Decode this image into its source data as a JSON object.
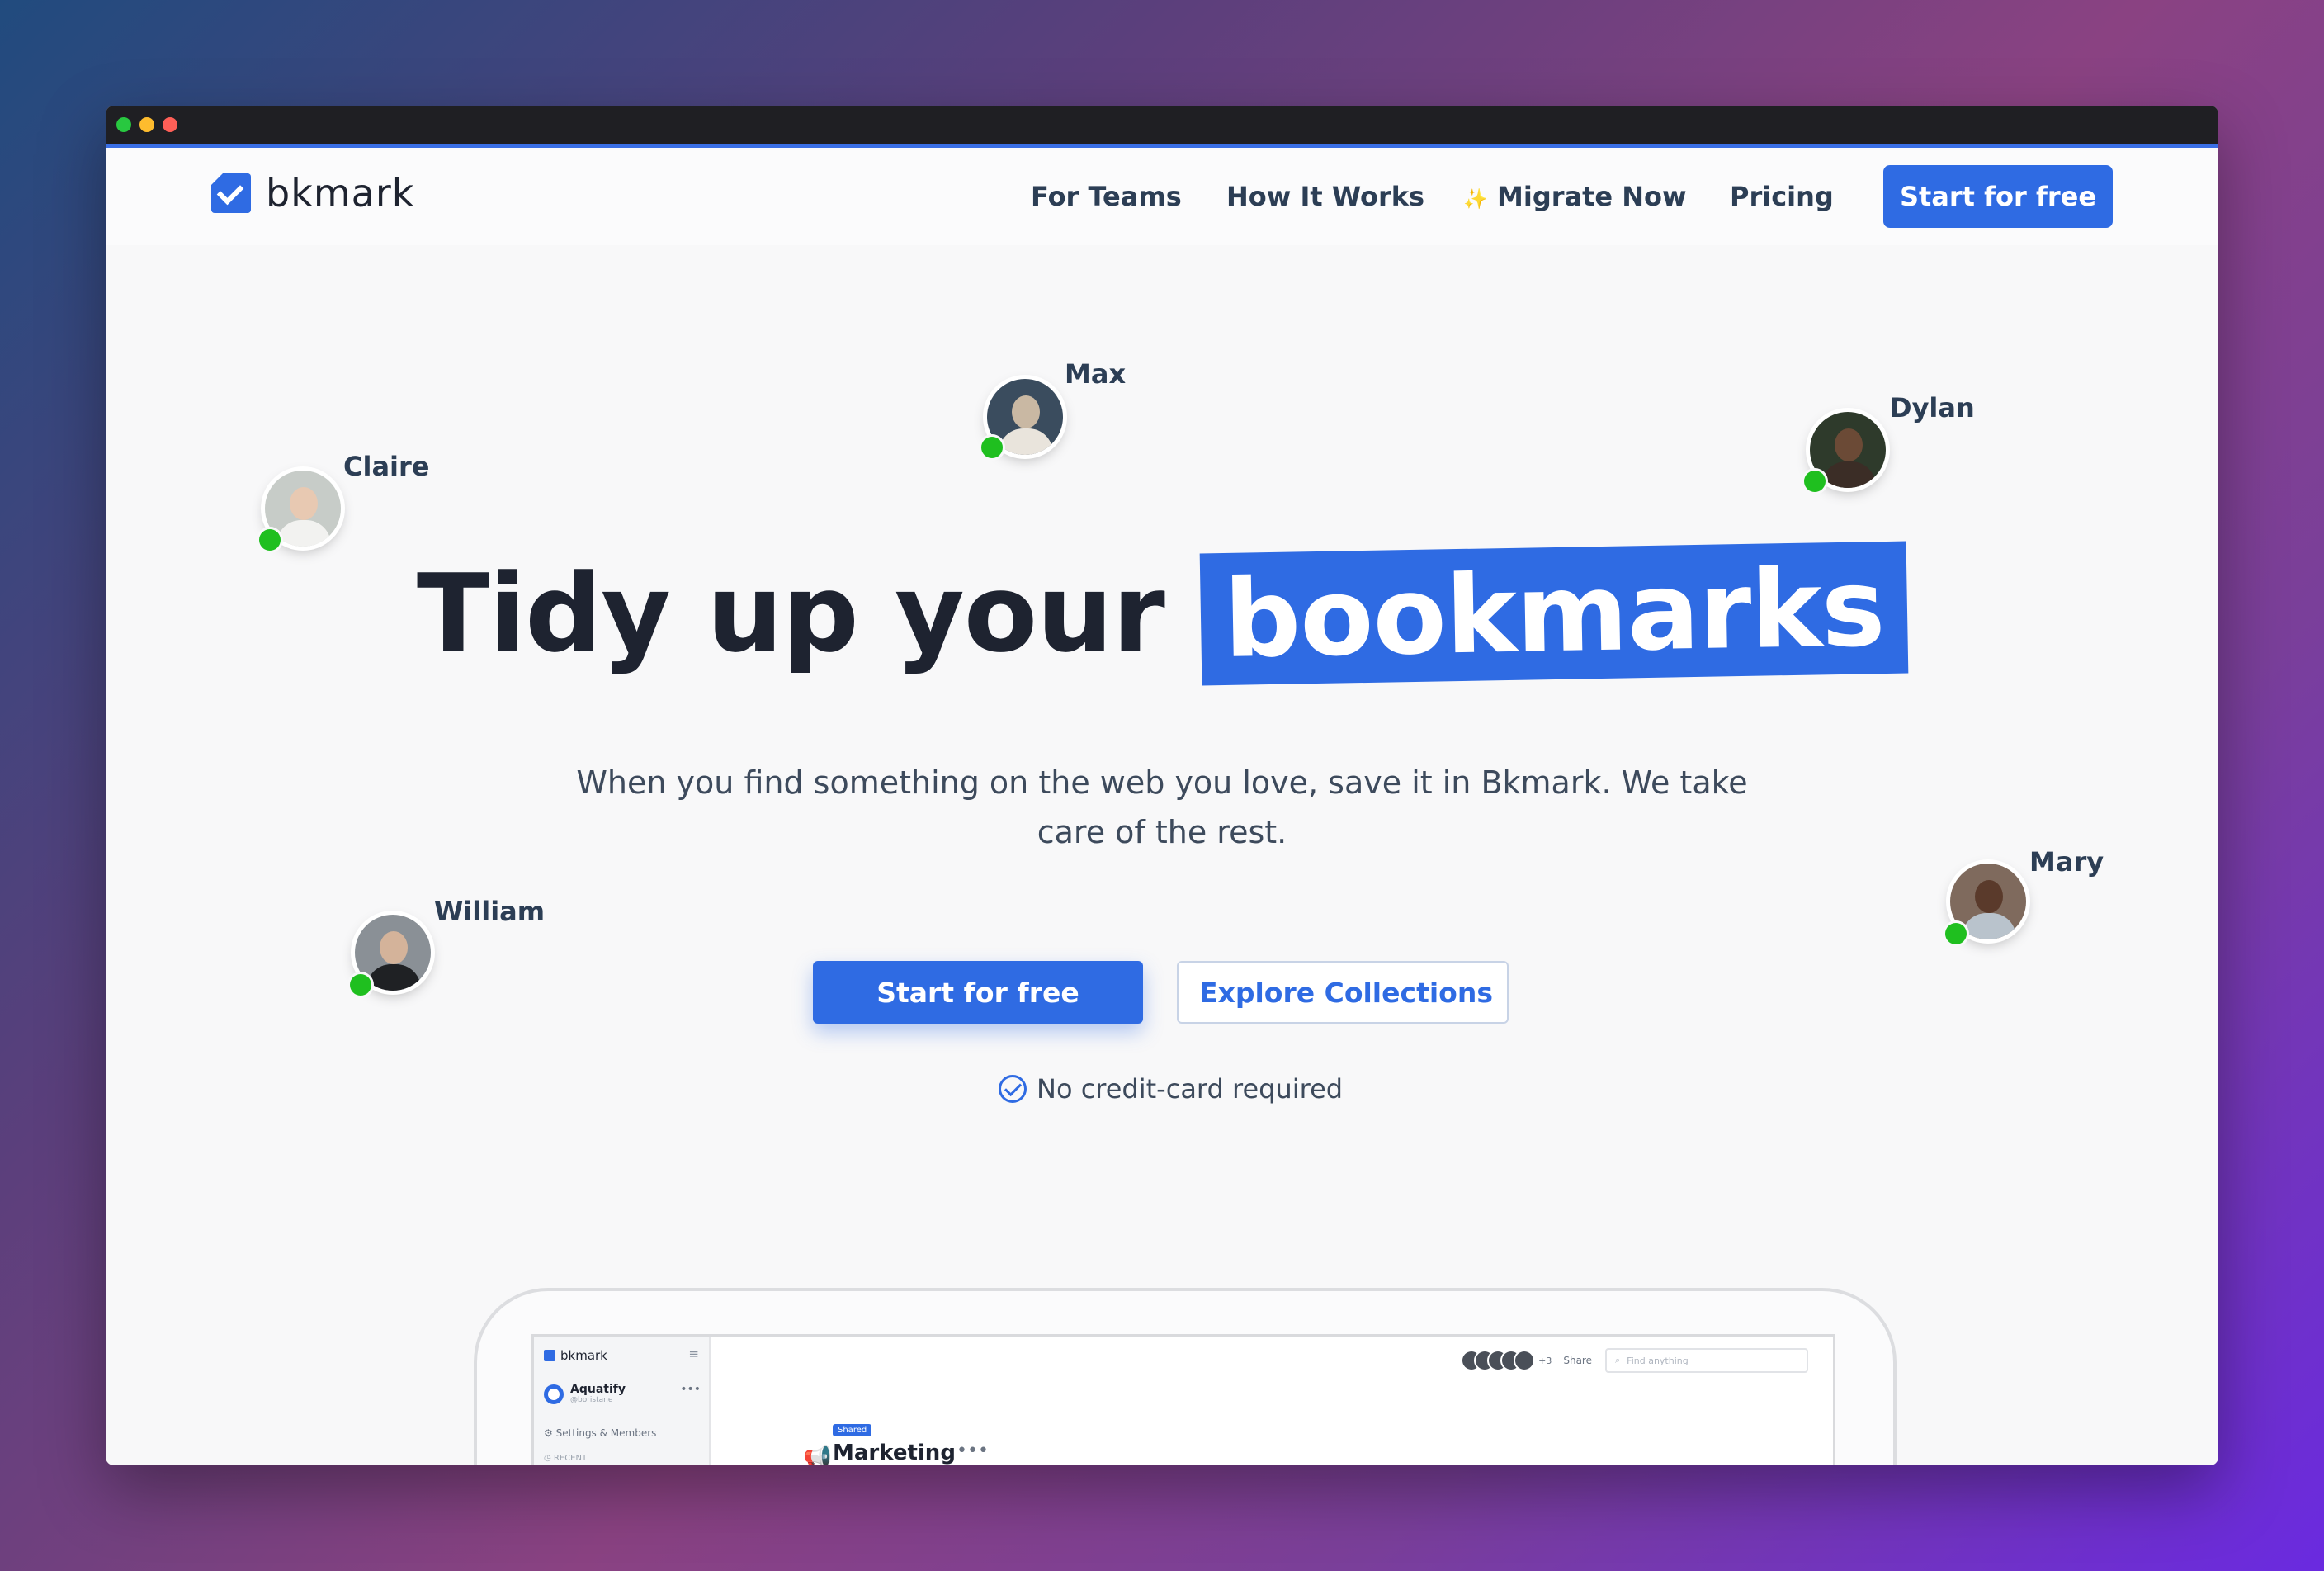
{
  "window": {
    "controls": [
      "green",
      "yellow",
      "red"
    ]
  },
  "nav": {
    "logo_text": "bkmark",
    "links": [
      "For Teams",
      "How It Works",
      "Migrate Now",
      "Pricing"
    ],
    "migrate_icon": "✨",
    "cta": "Start for free"
  },
  "avatars": [
    {
      "name": "Max"
    },
    {
      "name": "Dylan"
    },
    {
      "name": "Claire"
    },
    {
      "name": "William"
    },
    {
      "name": "Mary"
    }
  ],
  "hero": {
    "title_plain": "Tidy up your",
    "title_highlight": "bookmarks",
    "subtitle": "When you find something on the web you love, save it in Bkmark. We take care of the rest.",
    "primary_cta": "Start for free",
    "secondary_cta": "Explore Collections",
    "secondary_icon": "",
    "no_cc": "No credit-card required"
  },
  "app_preview": {
    "logo": "bkmark",
    "team_name": "Aquatify",
    "team_handle": "@boristane",
    "settings": "Settings & Members",
    "recent": "RECENT",
    "avatar_extra": "+3",
    "share": "Share",
    "search_placeholder": "Find anything",
    "badge": "Shared",
    "collection_title": "Marketing",
    "more": "•••"
  },
  "colors": {
    "accent": "#2f6be3",
    "status": "#1fbf1f",
    "text": "#1e2330"
  }
}
